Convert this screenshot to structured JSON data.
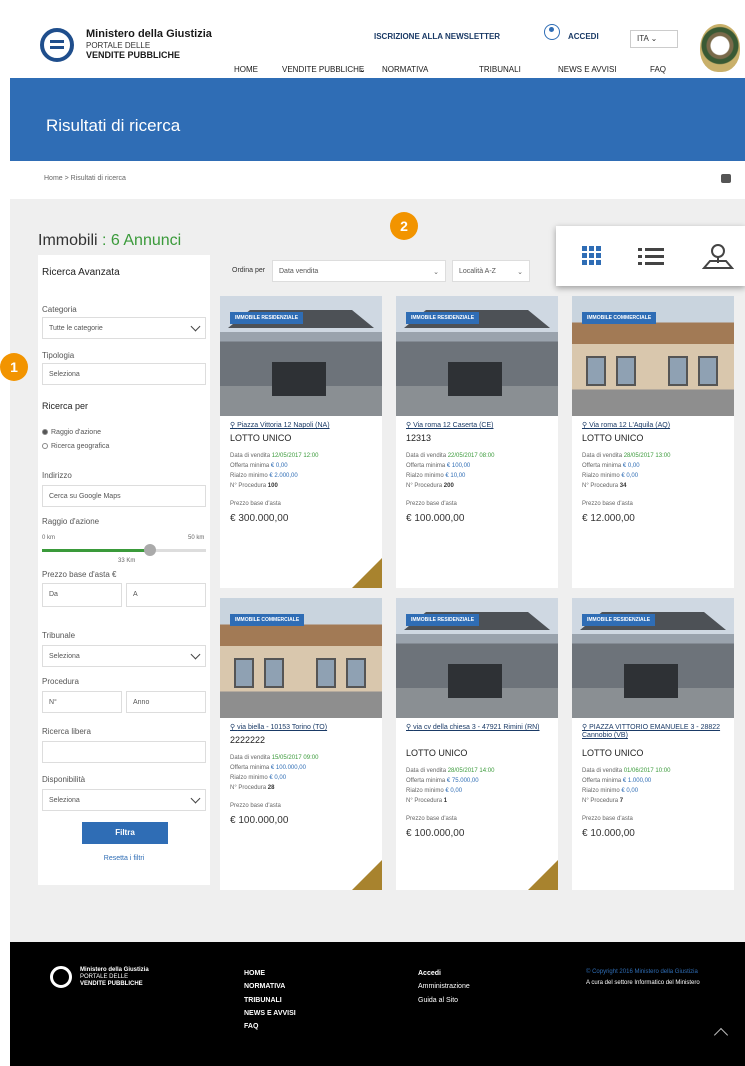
{
  "header": {
    "logo_line1": "Ministero della Giustizia",
    "logo_line2": "PORTALE DELLE",
    "logo_line3": "VENDITE PUBBLICHE",
    "newsletter": "ISCRIZIONE ALLA NEWSLETTER",
    "login": "ACCEDI",
    "language": "ITA",
    "nav": [
      "HOME",
      "VENDITE PUBBLICHE",
      "NORMATIVA",
      "TRIBUNALI",
      "NEWS E AVVISI",
      "FAQ"
    ]
  },
  "banner": {
    "title": "Risultati di ricerca"
  },
  "breadcrumb": {
    "text": "Home > Risultati di ricerca"
  },
  "results": {
    "label": "Immobili",
    "separator": ":",
    "count": "6 Annunci"
  },
  "sidebar": {
    "title": "Ricerca Avanzata",
    "categoria_label": "Categoria",
    "categoria_value": "Tutte le categorie",
    "tipologia_label": "Tipologia",
    "tipologia_value": "Seleziona",
    "ricerca_per": "Ricerca per",
    "radio1": "Raggio d'azione",
    "radio2": "Ricerca geografica",
    "indirizzo_label": "Indirizzo",
    "indirizzo_placeholder": "Cerca su Google Maps",
    "raggio_label": "Raggio d'azione",
    "raggio_min": "0 km",
    "raggio_max": "50 km",
    "raggio_value_label": "33 Km",
    "raggio_fraction": 0.66,
    "prezzo_label": "Prezzo base d'asta €",
    "prezzo_da": "Da",
    "prezzo_a": "A",
    "tribunale_label": "Tribunale",
    "tribunale_value": "Seleziona",
    "procedura_label": "Procedura",
    "procedura_n": "N°",
    "procedura_anno": "Anno",
    "ricerca_libera_label": "Ricerca libera",
    "disponibilita_label": "Disponibilità",
    "disponibilita_value": "Seleziona",
    "filter_btn": "Filtra",
    "reset": "Resetta i filtri"
  },
  "sort": {
    "label": "Ordina per",
    "option1": "Data vendita",
    "option2": "Località A-Z"
  },
  "badges": {
    "one": "1",
    "two": "2"
  },
  "cards": [
    {
      "tag": "IMMOBILE RESIDENZIALE",
      "addr": "Piazza Vittoria 12 Napoli (NA)",
      "lot": "LOTTO UNICO",
      "date_lbl": "Data di vendita",
      "date": "12/05/2017 12:00",
      "offer_lbl": "Offerta minima",
      "offer": "€ 0,00",
      "raise_lbl": "Rialzo minimo",
      "raise": "€ 2.000,00",
      "proc_lbl": "N° Procedura",
      "proc": "100",
      "price_lbl": "Prezzo base d'asta",
      "price": "€ 300.000,00"
    },
    {
      "tag": "IMMOBILE RESIDENZIALE",
      "addr": "Via roma 12 Caserta (CE)",
      "lot": "12313",
      "date_lbl": "Data di vendita",
      "date": "22/05/2017 08:00",
      "offer_lbl": "Offerta minima",
      "offer": "€ 100,00",
      "raise_lbl": "Rialzo minimo",
      "raise": "€ 10,00",
      "proc_lbl": "N° Procedura",
      "proc": "200",
      "price_lbl": "Prezzo base d'asta",
      "price": "€ 100.000,00"
    },
    {
      "tag": "IMMOBILE COMMERCIALE",
      "addr": "Via roma 12 L'Aquila (AQ)",
      "lot": "LOTTO UNICO",
      "date_lbl": "Data di vendita",
      "date": "28/05/2017 13:00",
      "offer_lbl": "Offerta minima",
      "offer": "€ 0,00",
      "raise_lbl": "Rialzo minimo",
      "raise": "€ 0,00",
      "proc_lbl": "N° Procedura",
      "proc": "34",
      "price_lbl": "Prezzo base d'asta",
      "price": "€ 12.000,00"
    },
    {
      "tag": "IMMOBILE COMMERCIALE",
      "addr": "via biella - 10153 Torino (TO)",
      "lot": "2222222",
      "date_lbl": "Data di vendita",
      "date": "15/05/2017 09:00",
      "offer_lbl": "Offerta minima",
      "offer": "€ 100.000,00",
      "raise_lbl": "Rialzo minimo",
      "raise": "€ 0,00",
      "proc_lbl": "N° Procedura",
      "proc": "28",
      "price_lbl": "Prezzo base d'asta",
      "price": "€ 100.000,00"
    },
    {
      "tag": "IMMOBILE RESIDENZIALE",
      "addr": "via cv della chiesa 3 - 47921 Rimini (RN)",
      "lot": "LOTTO UNICO",
      "date_lbl": "Data di vendita",
      "date": "28/05/2017 14:00",
      "offer_lbl": "Offerta minima",
      "offer": "€ 75.000,00",
      "raise_lbl": "Rialzo minimo",
      "raise": "€ 0,00",
      "proc_lbl": "N° Procedura",
      "proc": "1",
      "price_lbl": "Prezzo base d'asta",
      "price": "€ 100.000,00"
    },
    {
      "tag": "IMMOBILE RESIDENZIALE",
      "addr": "PIAZZA VITTORIO EMANUELE 3 - 28822 Cannobio (VB)",
      "lot": "LOTTO UNICO",
      "date_lbl": "Data di vendita",
      "date": "01/06/2017 10:00",
      "offer_lbl": "Offerta minima",
      "offer": "€ 1.000,00",
      "raise_lbl": "Rialzo minimo",
      "raise": "€ 0,00",
      "proc_lbl": "N° Procedura",
      "proc": "7",
      "price_lbl": "Prezzo base d'asta",
      "price": "€ 10.000,00"
    }
  ],
  "footer": {
    "logo_line1": "Ministero della Giustizia",
    "logo_line2": "PORTALE DELLE",
    "logo_line3": "VENDITE PUBBLICHE",
    "col1": [
      "HOME",
      "NORMATIVA",
      "TRIBUNALI",
      "NEWS E AVVISI",
      "FAQ"
    ],
    "col2": [
      "Accedi",
      "Amministrazione",
      "Guida al Sito"
    ],
    "copyright": "© Copyright 2016 Ministero della Giustizia",
    "credit": "A cura del settore Informatico del Ministero"
  }
}
